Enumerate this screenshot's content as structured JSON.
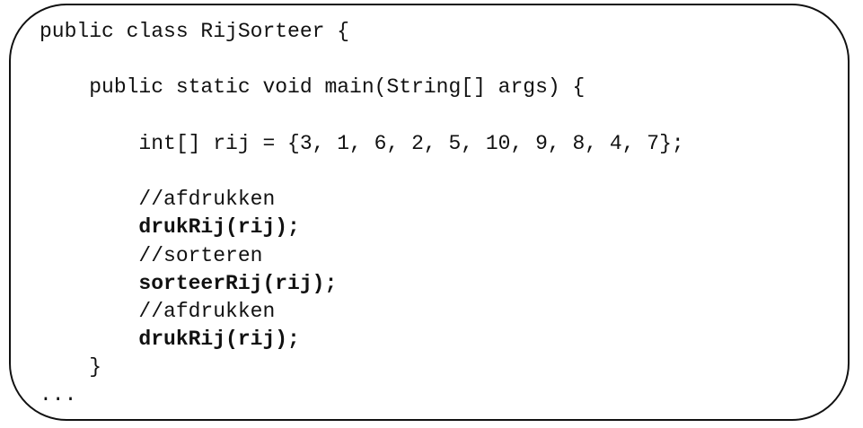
{
  "code": {
    "lines": [
      "public class RijSorteer {",
      "",
      "    public static void main(String[] args) {",
      "",
      "        int[] rij = {3, 1, 6, 2, 5, 10, 9, 8, 4, 7};",
      "",
      "        //afdrukken",
      "        drukRij(rij);",
      "        //sorteren",
      "        sorteerRij(rij);",
      "        //afdrukken",
      "        drukRij(rij);",
      "    }",
      "..."
    ]
  }
}
